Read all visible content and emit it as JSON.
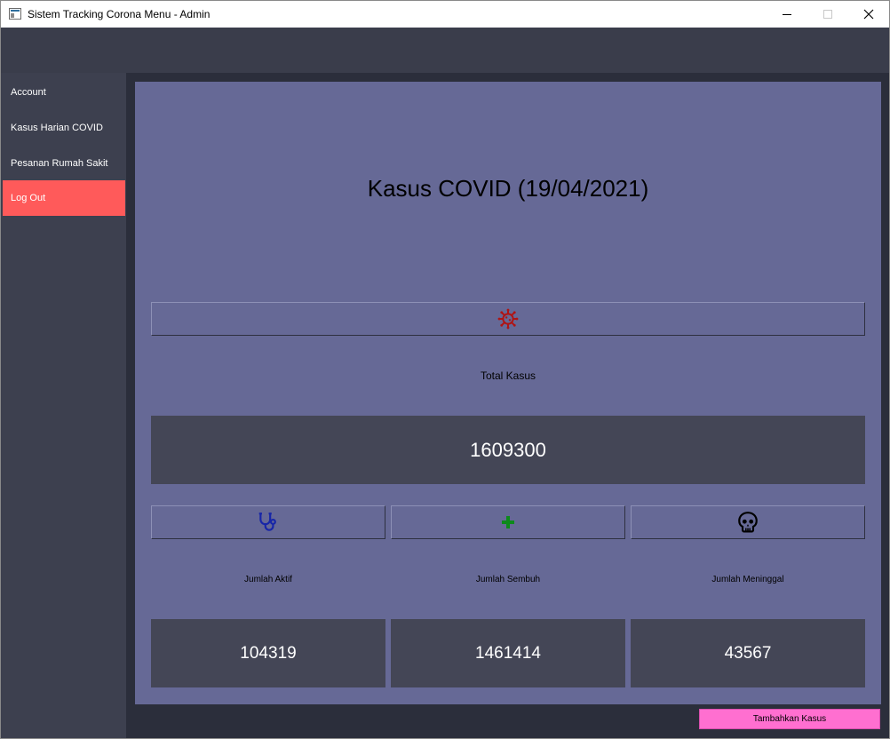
{
  "window": {
    "title": "Sistem Tracking Corona Menu - Admin"
  },
  "sidebar": {
    "items": [
      {
        "label": "Account"
      },
      {
        "label": "Kasus Harian COVID"
      },
      {
        "label": "Pesanan Rumah Sakit"
      },
      {
        "label": "Log Out"
      }
    ]
  },
  "main": {
    "title": "Kasus COVID (19/04/2021)",
    "total": {
      "label": "Total Kasus",
      "value": "1609300",
      "icon": "virus-icon",
      "icon_color": "#b01313"
    },
    "stats": [
      {
        "label": "Jumlah Aktif",
        "value": "104319",
        "icon": "stethoscope-icon",
        "icon_color": "#1726a8"
      },
      {
        "label": "Jumlah Sembuh",
        "value": "1461414",
        "icon": "plus-icon",
        "icon_color": "#0d8a1c"
      },
      {
        "label": "Jumlah Meninggal",
        "value": "43567",
        "icon": "skull-icon",
        "icon_color": "#000000"
      }
    ]
  },
  "footer": {
    "add_label": "Tambahkan Kasus"
  },
  "colors": {
    "panel": "#666996",
    "sidebar": "#3d404f",
    "logout_active": "#ff5a5a",
    "value_box": "#444656",
    "add_button": "#ff6fd0"
  }
}
